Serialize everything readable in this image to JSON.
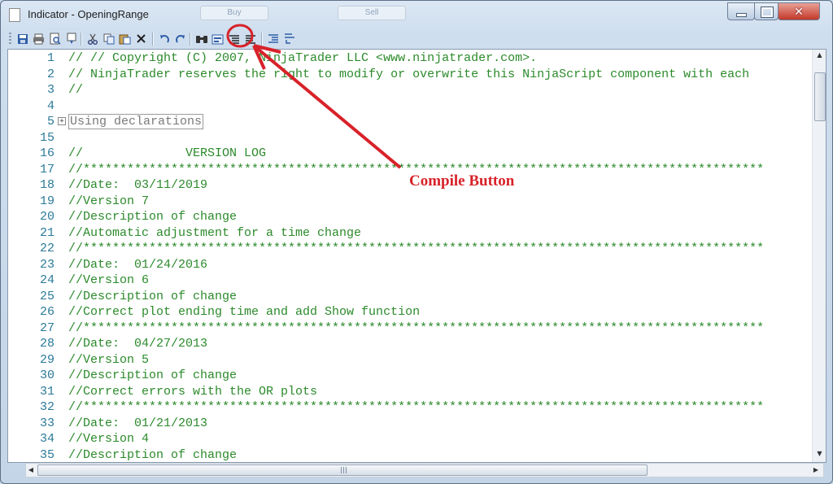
{
  "window": {
    "title": "Indicator - OpeningRange",
    "ghost_buttons": [
      "Buy",
      "Sell"
    ],
    "controls": {
      "minimize_icon": "minimize-icon",
      "maximize_icon": "maximize-icon",
      "close_icon": "close-icon"
    }
  },
  "toolbar": {
    "icons": [
      "save-icon",
      "print-icon",
      "print-preview-icon",
      "properties-icon",
      "cut-icon",
      "copy-icon",
      "paste-icon",
      "delete-icon",
      "undo-icon",
      "redo-icon",
      "find-icon",
      "compile-icon",
      "comment-icon",
      "uncomment-icon",
      "indent-icon",
      "outdent-icon"
    ]
  },
  "editor": {
    "lines": [
      {
        "num": "1",
        "text": "// // Copyright (C) 2007, NinjaTrader LLC <www.ninjatrader.com>."
      },
      {
        "num": "2",
        "text": "// NinjaTrader reserves the right to modify or overwrite this NinjaScript component with each"
      },
      {
        "num": "3",
        "text": "//"
      },
      {
        "num": "4",
        "text": ""
      },
      {
        "num": "5",
        "text": "Using declarations",
        "region": true
      },
      {
        "num": "15",
        "text": ""
      },
      {
        "num": "16",
        "text": "//              VERSION LOG"
      },
      {
        "num": "17",
        "text": "//*********************************************************************************************"
      },
      {
        "num": "18",
        "text": "//Date:  03/11/2019"
      },
      {
        "num": "19",
        "text": "//Version 7"
      },
      {
        "num": "20",
        "text": "//Description of change"
      },
      {
        "num": "21",
        "text": "//Automatic adjustment for a time change"
      },
      {
        "num": "22",
        "text": "//*********************************************************************************************"
      },
      {
        "num": "23",
        "text": "//Date:  01/24/2016"
      },
      {
        "num": "24",
        "text": "//Version 6"
      },
      {
        "num": "25",
        "text": "//Description of change"
      },
      {
        "num": "26",
        "text": "//Correct plot ending time and add Show function"
      },
      {
        "num": "27",
        "text": "//*********************************************************************************************"
      },
      {
        "num": "28",
        "text": "//Date:  04/27/2013"
      },
      {
        "num": "29",
        "text": "//Version 5"
      },
      {
        "num": "30",
        "text": "//Description of change"
      },
      {
        "num": "31",
        "text": "//Correct errors with the OR plots"
      },
      {
        "num": "32",
        "text": "//*********************************************************************************************"
      },
      {
        "num": "33",
        "text": "//Date:  01/21/2013"
      },
      {
        "num": "34",
        "text": "//Version 4"
      },
      {
        "num": "35",
        "text": "//Description of change"
      }
    ]
  },
  "annotation": {
    "label": "Compile Button",
    "color": "#d8222a"
  },
  "colors": {
    "comment": "#2b8a2b",
    "line_number": "#2b7a99"
  }
}
